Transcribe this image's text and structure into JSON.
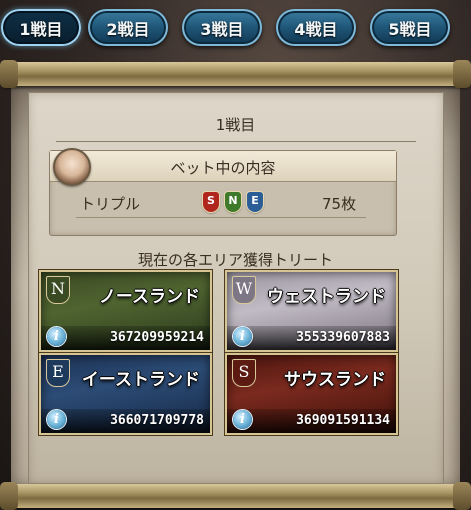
{
  "tabs": [
    {
      "label": "1戦目",
      "active": true
    },
    {
      "label": "2戦目",
      "active": false
    },
    {
      "label": "3戦目",
      "active": false
    },
    {
      "label": "4戦目",
      "active": false
    },
    {
      "label": "5戦目",
      "active": false
    }
  ],
  "panel": {
    "title": "1戦目",
    "bet": {
      "header": "ベット中の内容",
      "type": "トリプル",
      "emblems": [
        "S",
        "N",
        "E"
      ],
      "amount": "75枚"
    },
    "section_heading": "現在の各エリア獲得トリート",
    "areas": [
      {
        "letter": "N",
        "name": "ノースランド",
        "value": "367209959214"
      },
      {
        "letter": "W",
        "name": "ウェストランド",
        "value": "355339607883"
      },
      {
        "letter": "E",
        "name": "イーストランド",
        "value": "366071709778"
      },
      {
        "letter": "S",
        "name": "サウスランド",
        "value": "369091591134"
      }
    ],
    "info_icon_glyph": "i"
  },
  "colors": {
    "tab_blue": "#1f5677",
    "emblem_south": "#b0261c",
    "emblem_north": "#3e7a2a",
    "emblem_east": "#2b5d97"
  }
}
